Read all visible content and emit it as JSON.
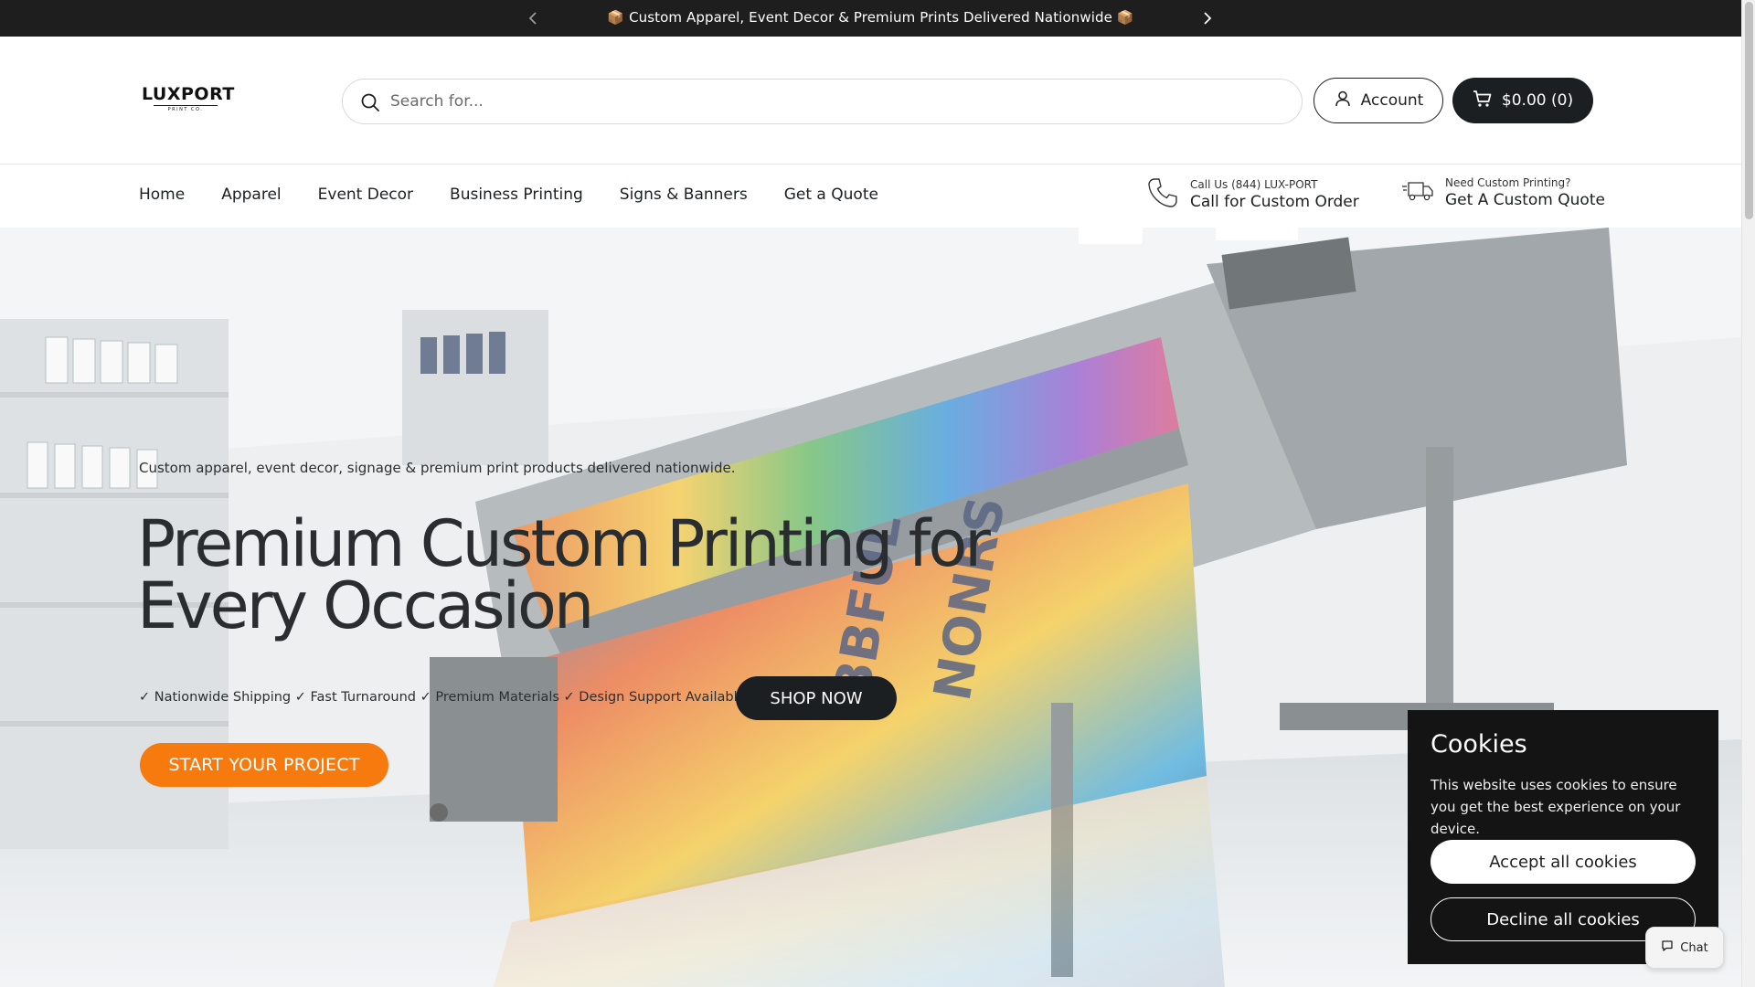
{
  "announcement": {
    "text": "📦 Custom Apparel, Event Decor & Premium Prints Delivered Nationwide 📦",
    "prev_icon": "chevron-left-icon",
    "next_icon": "chevron-right-icon"
  },
  "header": {
    "logo_text": "LUXPORT",
    "logo_subtext": "PRINT CO.",
    "search_placeholder": "Search for...",
    "account_label": "Account",
    "cart_label": "$0.00 (0)"
  },
  "nav": {
    "links": [
      "Home",
      "Apparel",
      "Event Decor",
      "Business Printing",
      "Signs & Banners",
      "Get a Quote"
    ],
    "phone": {
      "small": "Call Us (844) LUX-PORT",
      "big": "Call for Custom Order",
      "icon": "phone-icon"
    },
    "quote": {
      "small": "Need Custom Printing?",
      "big": "Get A Custom Quote",
      "icon": "delivery-truck-icon"
    }
  },
  "hero": {
    "tagline": "Custom apparel, event decor, signage & premium print products delivered nationwide.",
    "title": "Premium Custom Printing for Every Occasion",
    "features": "✓ Nationwide Shipping ✓ Fast Turnaround ✓ Premium Materials ✓ Design Support Available",
    "shop_button": "SHOP NOW",
    "start_button": "START YOUR PROJECT"
  },
  "cookies": {
    "title": "Cookies",
    "body": "This website uses cookies to ensure you get the best experience on your device.",
    "accept": "Accept all cookies",
    "decline": "Decline all cookies"
  },
  "chat": {
    "label": "Chat",
    "icon": "chat-bubble-icon"
  },
  "colors": {
    "dark": "#1c1f22",
    "announcement_bg": "#1e1e1e",
    "accent_orange": "#f77a0f",
    "cookie_bg": "#141414"
  }
}
